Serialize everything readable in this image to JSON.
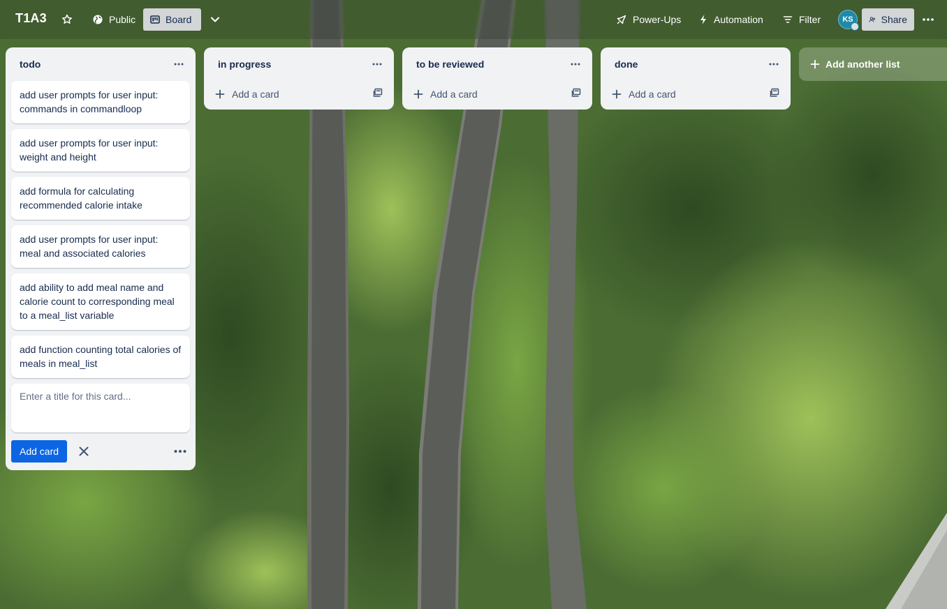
{
  "header": {
    "board_title": "T1A3",
    "visibility_label": "Public",
    "view_label": "Board",
    "powerups_label": "Power-Ups",
    "automation_label": "Automation",
    "filter_label": "Filter",
    "avatar_initials": "KS",
    "share_label": "Share"
  },
  "lists": [
    {
      "title": "todo",
      "cards": [
        "add user prompts for user input: commands in commandloop",
        "add user prompts for user input: weight and height",
        "add formula for calculating recommended calorie intake",
        "add user prompts for user input: meal and associated calories",
        "add ability to add meal name and calorie count to corresponding meal to a meal_list variable",
        "add function counting total calories of meals in meal_list"
      ],
      "composer": {
        "placeholder": "Enter a title for this card...",
        "submit_label": "Add card"
      }
    },
    {
      "title": "in progress",
      "add_card_label": "Add a card"
    },
    {
      "title": "to be reviewed",
      "add_card_label": "Add a card"
    },
    {
      "title": "done",
      "add_card_label": "Add a card"
    }
  ],
  "add_list_label": "Add another list",
  "colors": {
    "accent_button": "#0c66e4",
    "list_background": "#f1f2f4",
    "avatar": "#1e8aa8"
  },
  "icons": {
    "star": "star-icon",
    "globe": "globe-icon",
    "board": "board-icon",
    "chevron": "chevron-down-icon",
    "rocket": "rocket-icon",
    "bolt": "bolt-icon",
    "filter": "filter-icon",
    "share": "add-user-icon",
    "more": "more-icon",
    "plus": "plus-icon",
    "template": "template-icon",
    "close": "close-icon"
  }
}
